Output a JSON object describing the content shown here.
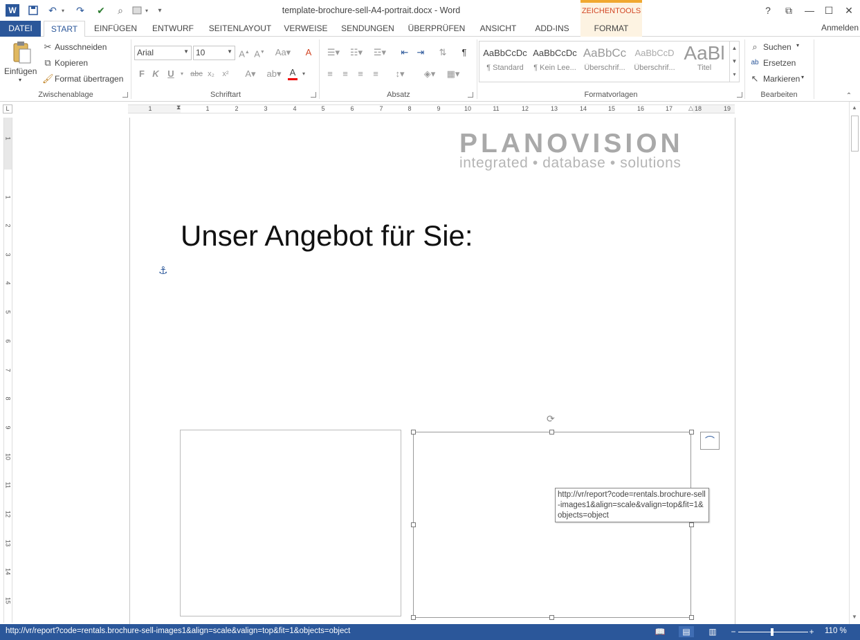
{
  "app": {
    "title": "template-brochure-sell-A4-portrait.docx - Word",
    "contextual_group": "ZEICHENTOOLS",
    "sign_in": "Anmelden",
    "window_controls": {
      "help": "?",
      "ribbon_display": "⧉",
      "minimize": "—",
      "maximize": "☐",
      "close": "✕"
    }
  },
  "quick_access": {
    "word_icon": "W",
    "save": "💾",
    "undo": "↶",
    "redo": "↷",
    "customize": "▾"
  },
  "tabs": {
    "datei": "DATEI",
    "start": "START",
    "einfuegen": "EINFÜGEN",
    "entwurf": "ENTWURF",
    "seitenlayout": "SEITENLAYOUT",
    "verweise": "VERWEISE",
    "sendungen": "SENDUNGEN",
    "ueberpruefen": "ÜBERPRÜFEN",
    "ansicht": "ANSICHT",
    "addins": "ADD-INS",
    "format": "FORMAT"
  },
  "ribbon": {
    "clipboard": {
      "paste": "Einfügen",
      "cut": "Ausschneiden",
      "copy": "Kopieren",
      "format_painter": "Format übertragen",
      "label": "Zwischenablage"
    },
    "font": {
      "family": "Arial",
      "size": "10",
      "label": "Schriftart",
      "bold": "F",
      "italic": "K",
      "underline": "U",
      "strike": "abc",
      "sub": "x₂",
      "sup": "x²"
    },
    "paragraph": {
      "label": "Absatz",
      "pilcrow": "¶"
    },
    "styles": {
      "label": "Formatvorlagen",
      "items": [
        {
          "sample": "AaBbCcDc",
          "name": "¶ Standard"
        },
        {
          "sample": "AaBbCcDc",
          "name": "¶ Kein Lee..."
        },
        {
          "sample": "AaBbCc",
          "name": "Überschrif..."
        },
        {
          "sample": "AaBbCcD",
          "name": "Überschrif..."
        },
        {
          "sample": "AaBl",
          "name": "Titel"
        }
      ]
    },
    "editing": {
      "find": "Suchen",
      "replace": "Ersetzen",
      "select": "Markieren",
      "label": "Bearbeiten"
    }
  },
  "ruler": {
    "corner": "L",
    "h_ticks": [
      "1",
      "1",
      "2",
      "3",
      "4",
      "5",
      "6",
      "7",
      "8",
      "9",
      "10",
      "11",
      "12",
      "13",
      "14",
      "15",
      "16",
      "17",
      "18",
      "19"
    ],
    "v_ticks": [
      "1",
      "1",
      "2",
      "3",
      "4",
      "5",
      "6",
      "7",
      "8",
      "9",
      "10",
      "11",
      "12",
      "13",
      "14",
      "15"
    ]
  },
  "document": {
    "logo_main": "PLANOVISION",
    "logo_sub": "integrated • database • solutions",
    "heading": "Unser Angebot für Sie:",
    "tooltip": "http://vr/report?code=rentals.brochure-sell-images1&align=scale&valign=top&fit=1&objects=object"
  },
  "status": {
    "url": "http://vr/report?code=rentals.brochure-sell-images1&align=scale&valign=top&fit=1&objects=object",
    "zoom": "110 %",
    "zoom_minus": "−",
    "zoom_plus": "+"
  },
  "colors": {
    "accent": "#2b579a",
    "contextual": "#f0a830",
    "contextual_text": "#d24726"
  }
}
